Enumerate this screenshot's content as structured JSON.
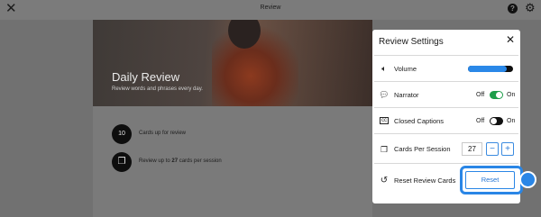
{
  "topbar": {
    "title": "Review",
    "close_icon": "close-icon",
    "help_icon": "help-icon",
    "settings_icon": "gear-icon",
    "help_glyph": "?"
  },
  "hero": {
    "title": "Daily Review",
    "subtitle": "Review words and phrases every day."
  },
  "summary": {
    "cards_up": {
      "count": "10",
      "text": "Cards up for review"
    },
    "per_session": {
      "icon": "cards-icon",
      "prefix": "Review up to ",
      "count": "27",
      "suffix": " cards per session"
    }
  },
  "settings": {
    "title": "Review Settings",
    "volume": {
      "label": "Volume",
      "icon": "speaker-icon",
      "level": 0.85
    },
    "narrator": {
      "label": "Narrator",
      "icon": "speech-bubble-icon",
      "off": "Off",
      "on": "On",
      "state": "on"
    },
    "closed_captions": {
      "label": "Closed Captions",
      "icon": "cc-icon",
      "off": "Off",
      "on": "On",
      "state": "off"
    },
    "cards_per_session": {
      "label": "Cards Per Session",
      "icon": "cards-icon",
      "value": "27",
      "minus": "−",
      "plus": "+"
    },
    "reset": {
      "label": "Reset Review Cards",
      "icon": "reset-icon",
      "button": "Reset"
    }
  },
  "colors": {
    "accent": "#2a86e6",
    "toggle_on": "#1d9e4a"
  }
}
